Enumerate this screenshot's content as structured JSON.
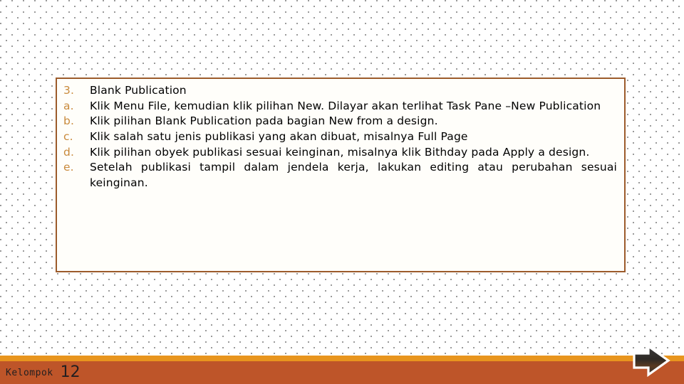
{
  "slide": {
    "background_color": "#ffffff",
    "dot_color": "#8a8a8a",
    "box": {
      "border_color": "#9C5B2B",
      "fill_color": "#FFFEFA"
    },
    "marker_color": "#C98A3C",
    "text_color": "#000000"
  },
  "content": {
    "items": [
      {
        "marker": "3.",
        "text": "Blank Publication"
      },
      {
        "marker": "a.",
        "text": "Klik Menu File, kemudian klik pilihan New. Dilayar akan terlihat Task Pane –New Publication"
      },
      {
        "marker": "b.",
        "text": "Klik pilihan Blank Publication pada bagian New from a design."
      },
      {
        "marker": "c.",
        "text": "Klik salah satu jenis publikasi yang akan dibuat, misalnya Full Page"
      },
      {
        "marker": "d.",
        "text": "Klik pilihan obyek publikasi sesuai keinginan, misalnya klik Bithday pada Apply a design."
      },
      {
        "marker": "e.",
        "text": "Setelah publikasi tampil dalam jendela kerja, lakukan editing atau perubahan sesuai keinginan."
      }
    ]
  },
  "footer": {
    "label": "Kelompok",
    "number": "12",
    "stripe_color": "#E8951E",
    "bar_color": "#BE5529",
    "next_arrow_icon": "next-arrow-icon"
  }
}
